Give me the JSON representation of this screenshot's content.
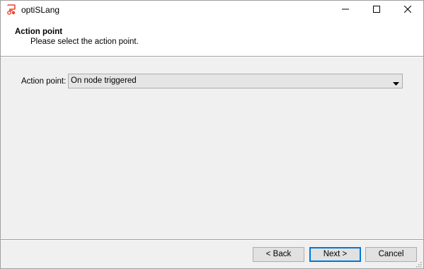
{
  "window": {
    "title": "optiSLang",
    "icons": {
      "app": "optislang-logo-icon",
      "minimize": "minimize-icon",
      "maximize": "maximize-icon",
      "close": "close-icon"
    }
  },
  "header": {
    "title": "Action point",
    "subtitle": "Please select the action point."
  },
  "form": {
    "action_point_label": "Action point:",
    "action_point_value": "On node triggered",
    "dropdown_icon": "chevron-down-icon"
  },
  "buttons": {
    "back": "< Back",
    "next": "Next >",
    "cancel": "Cancel"
  },
  "colors": {
    "accent": "#0078d7",
    "logo": "#e8452c"
  }
}
